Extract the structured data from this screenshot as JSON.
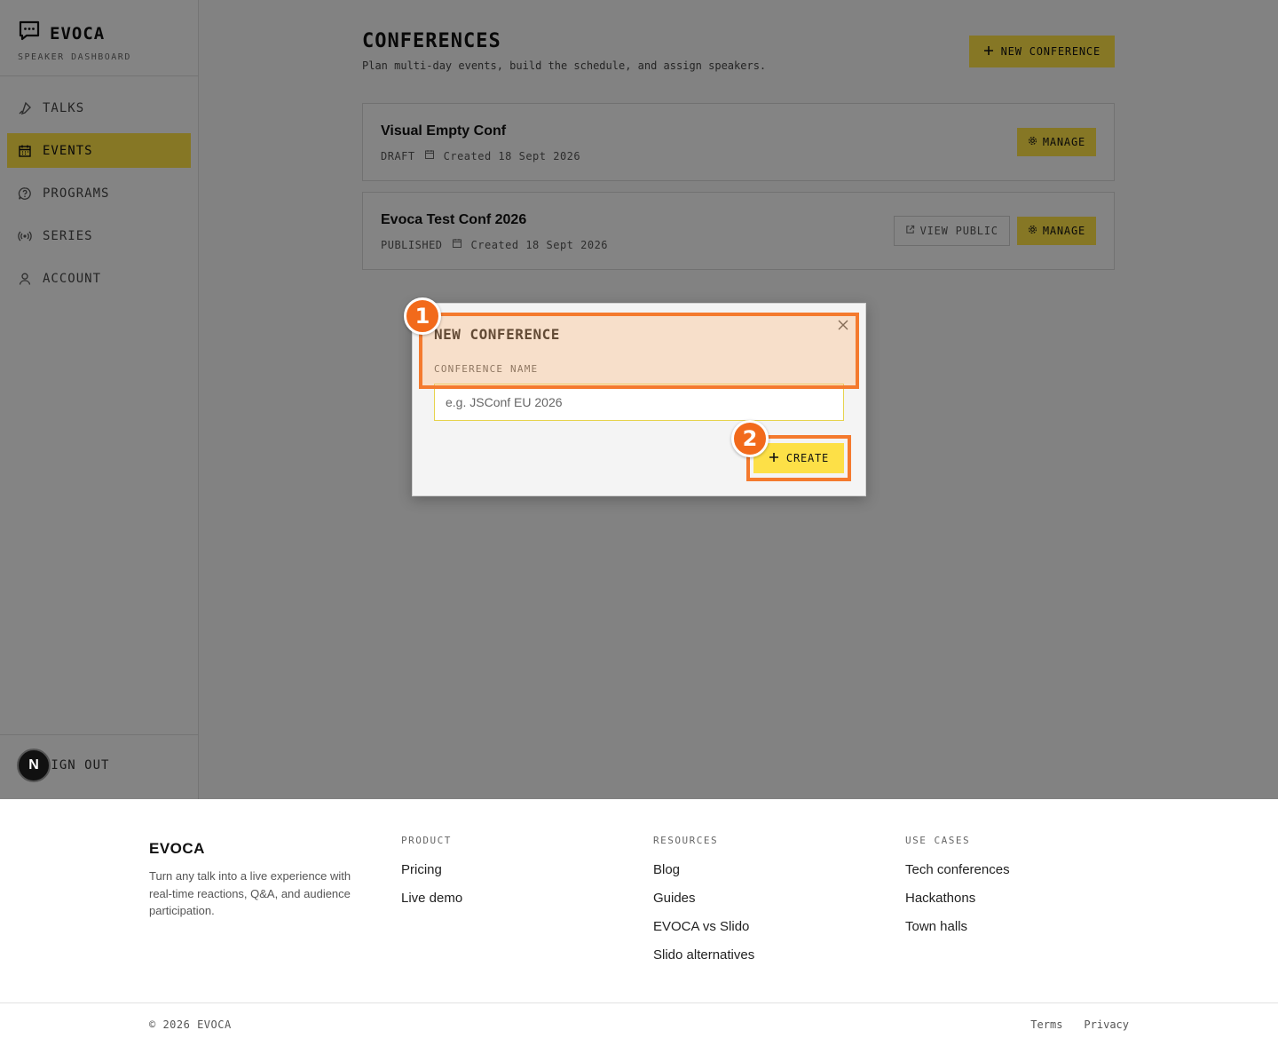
{
  "sidebar": {
    "brand": "EVOCA",
    "brand_sub": "SPEAKER DASHBOARD",
    "items": [
      {
        "label": "TALKS",
        "icon": "mic-icon"
      },
      {
        "label": "EVENTS",
        "icon": "calendar-icon",
        "active": true
      },
      {
        "label": "PROGRAMS",
        "icon": "help-circle-icon"
      },
      {
        "label": "SERIES",
        "icon": "broadcast-icon"
      },
      {
        "label": "ACCOUNT",
        "icon": "user-icon"
      }
    ],
    "sign_out": "SIGN OUT",
    "badge": "N"
  },
  "main": {
    "title": "CONFERENCES",
    "subtitle": "Plan multi-day events, build the schedule, and assign speakers.",
    "new_button": "NEW CONFERENCE",
    "conferences": [
      {
        "name": "Visual Empty Conf",
        "status": "DRAFT",
        "created": "Created 18 Sept 2026",
        "manage": "MANAGE"
      },
      {
        "name": "Evoca Test Conf 2026",
        "status": "PUBLISHED",
        "created": "Created 18 Sept 2026",
        "view": "VIEW PUBLIC",
        "manage": "MANAGE"
      }
    ]
  },
  "modal": {
    "title": "NEW CONFERENCE",
    "field_label": "CONFERENCE NAME",
    "placeholder": "e.g. JSConf EU 2026",
    "value": "",
    "create": "CREATE"
  },
  "annotations": {
    "marker1": "1",
    "marker2": "2",
    "color": "#f26a1b"
  },
  "footer": {
    "brand": "EVOCA",
    "description": "Turn any talk into a live experience with real-time reactions, Q&A, and audience participation.",
    "product": {
      "title": "PRODUCT",
      "links": [
        "Pricing",
        "Live demo"
      ]
    },
    "resources": {
      "title": "RESOURCES",
      "links": [
        "Blog",
        "Guides",
        "EVOCA vs Slido",
        "Slido alternatives"
      ]
    },
    "use_cases": {
      "title": "USE CASES",
      "links": [
        "Tech conferences",
        "Hackathons",
        "Town halls"
      ]
    },
    "copyright": "© 2026 EVOCA",
    "terms": "Terms",
    "privacy": "Privacy"
  },
  "colors": {
    "accent": "#fde047",
    "highlight": "#f47a2e"
  }
}
